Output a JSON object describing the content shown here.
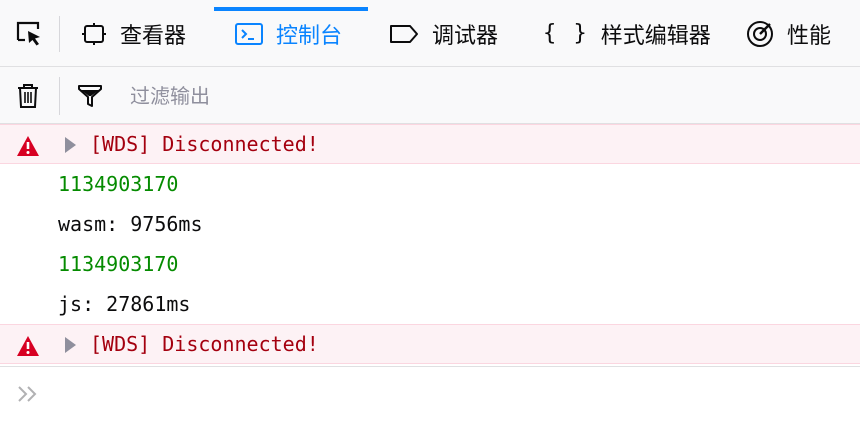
{
  "toolbar": {
    "tabs": [
      {
        "label": "查看器"
      },
      {
        "label": "控制台"
      },
      {
        "label": "调试器"
      },
      {
        "label": "样式编辑器"
      },
      {
        "label": "性能"
      }
    ]
  },
  "filterbar": {
    "placeholder": "过滤输出",
    "value": ""
  },
  "console": {
    "messages": [
      {
        "level": "warn",
        "text": "[WDS] Disconnected!"
      },
      {
        "level": "log-number",
        "text": "1134903170"
      },
      {
        "level": "log",
        "text": "wasm: 9756ms"
      },
      {
        "level": "log-number",
        "text": "1134903170"
      },
      {
        "level": "log",
        "text": "js: 27861ms"
      },
      {
        "level": "warn",
        "text": "[WDS] Disconnected!"
      }
    ],
    "prompt": {
      "value": ""
    }
  },
  "colors": {
    "accent": "#0a84ff",
    "warn_text": "#a4000f",
    "warn_bg": "#fdf2f5",
    "number": "#058b00"
  }
}
